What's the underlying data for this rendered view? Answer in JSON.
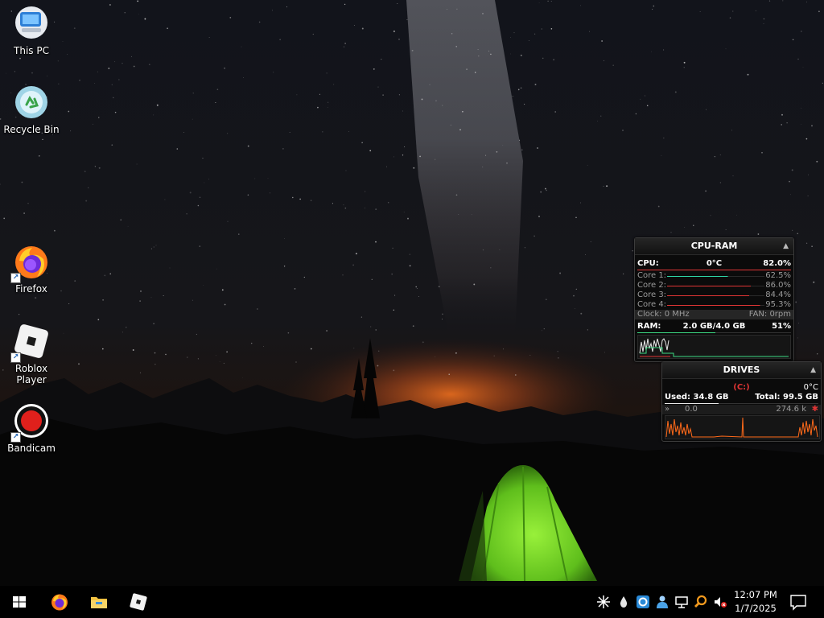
{
  "desktop": {
    "icons": [
      {
        "label": "This PC",
        "icon": "computer-icon"
      },
      {
        "label": "Recycle Bin",
        "icon": "recycle-bin-icon"
      },
      {
        "label": "Firefox",
        "icon": "firefox-icon"
      },
      {
        "label": "Roblox Player",
        "icon": "roblox-icon"
      },
      {
        "label": "Bandicam",
        "icon": "bandicam-icon"
      }
    ],
    "shortcut_arrow": "↗"
  },
  "cpu_ram": {
    "title": "CPU-RAM",
    "collapse_glyph": "▲",
    "cpu_label": "CPU:",
    "cpu_temp": "0°C",
    "cpu_total": "82.0%",
    "cores": [
      {
        "label": "Core 1:",
        "value": "62.5%",
        "fraction": 0.625,
        "color": "#2fd6a8"
      },
      {
        "label": "Core 2:",
        "value": "86.0%",
        "fraction": 0.86,
        "color": "#e03535"
      },
      {
        "label": "Core 3:",
        "value": "84.4%",
        "fraction": 0.844,
        "color": "#e03535"
      },
      {
        "label": "Core 4:",
        "value": "95.3%",
        "fraction": 0.953,
        "color": "#e03535"
      }
    ],
    "clock": "Clock: 0 MHz",
    "fan": "FAN: 0rpm",
    "ram_label": "RAM:",
    "ram_usage": "2.0 GB/4.0 GB",
    "ram_percent": "51%",
    "ram_fraction": 0.51
  },
  "drives": {
    "title": "DRIVES",
    "collapse_glyph": "▲",
    "drive_letter": "(C:)",
    "temp": "0°C",
    "used": "Used: 34.8 GB",
    "total": "Total: 99.5 GB",
    "read": "0.0",
    "write": "274.6 k",
    "used_fraction": 0.35
  },
  "taskbar": {
    "pinned": [
      "start-button",
      "firefox-taskbar-button",
      "file-explorer-taskbar-button",
      "roblox-taskbar-button"
    ],
    "clock_time": "12:07 PM",
    "clock_date": "1/7/2025"
  },
  "colors": {
    "tent": "#7ee02a",
    "horizon_glow": "#d9661c",
    "gadget_bg": "#0b0b0b"
  }
}
